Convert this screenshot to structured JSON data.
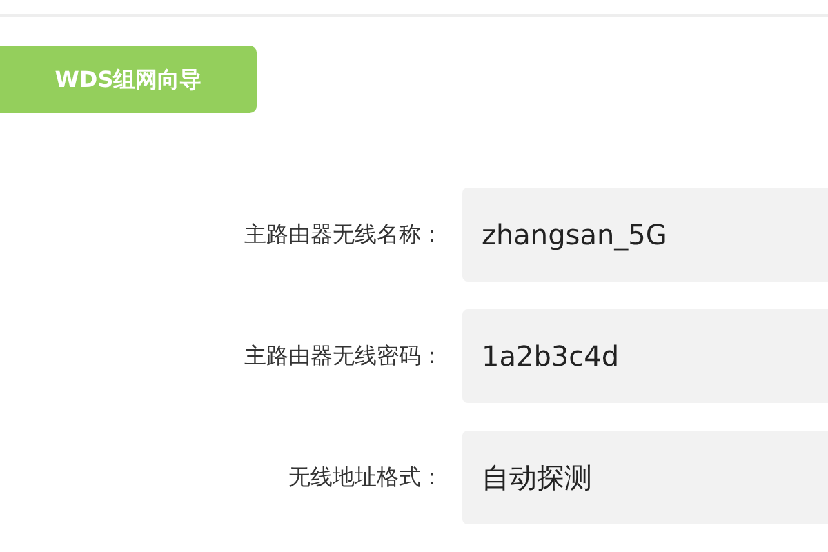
{
  "wizard_button": {
    "label": "WDS组网向导"
  },
  "fields": [
    {
      "label": "主路由器无线名称：",
      "value": "zhangsan_5G"
    },
    {
      "label": "主路由器无线密码：",
      "value": "1a2b3c4d"
    },
    {
      "label": "无线地址格式：",
      "value": "自动探测"
    }
  ]
}
